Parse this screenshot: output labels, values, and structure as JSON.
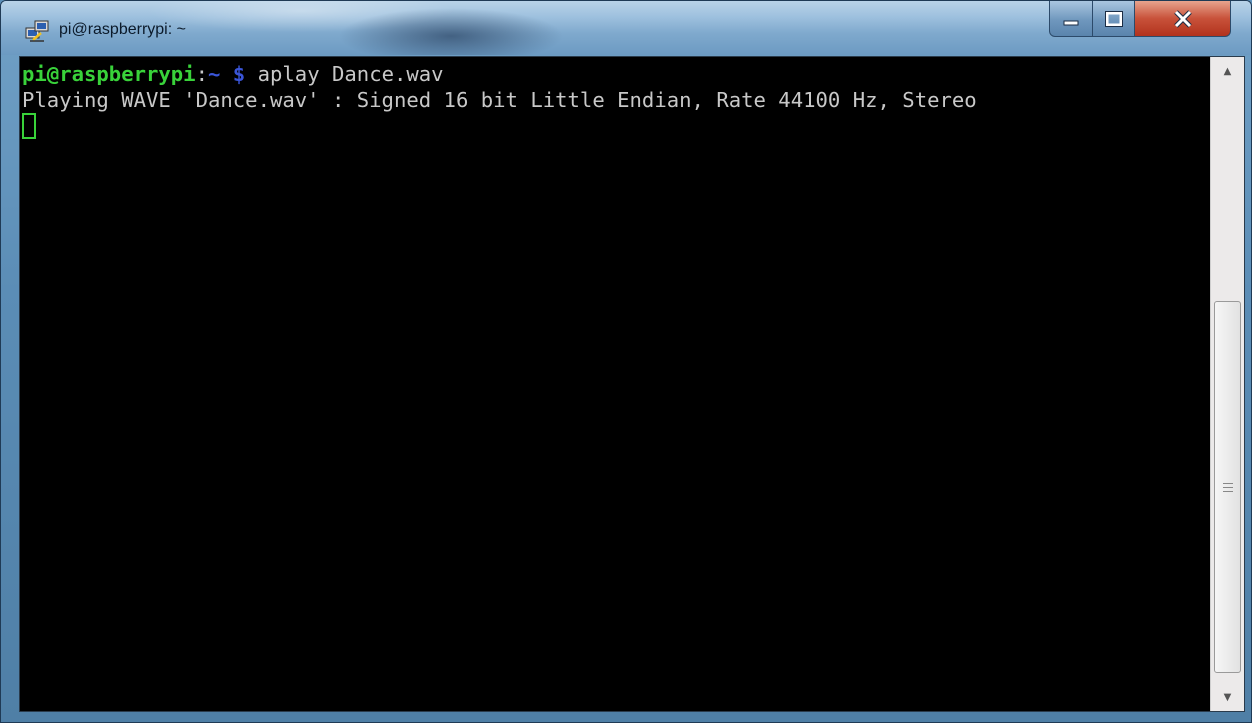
{
  "window": {
    "title": "pi@raspberrypi: ~"
  },
  "controls": {
    "minimize_icon": "minimize-icon",
    "maximize_icon": "maximize-icon",
    "close_icon": "close-icon"
  },
  "terminal": {
    "prompt_user_host": "pi@raspberrypi",
    "prompt_separator": ":",
    "prompt_path": "~ $",
    "command": " aplay Dance.wav",
    "output_line": "Playing WAVE 'Dance.wav' : Signed 16 bit Little Endian, Rate 44100 Hz, Stereo"
  },
  "colors": {
    "prompt_user": "#39d23a",
    "prompt_path": "#3a55d8",
    "text": "#c8c8c8",
    "background": "#000000",
    "close_button": "#c8523a"
  }
}
